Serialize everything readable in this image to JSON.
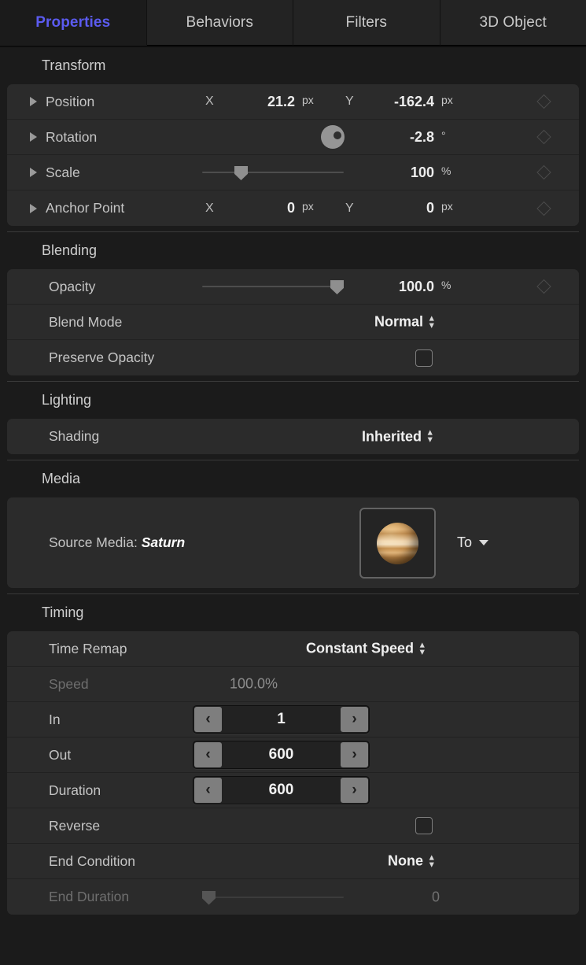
{
  "tabs": [
    {
      "label": "Properties",
      "active": true
    },
    {
      "label": "Behaviors",
      "active": false
    },
    {
      "label": "Filters",
      "active": false
    },
    {
      "label": "3D Object",
      "active": false
    }
  ],
  "sections": {
    "transform": {
      "title": "Transform",
      "position": {
        "label": "Position",
        "x_axis": "X",
        "x_value": "21.2",
        "x_unit": "px",
        "y_axis": "Y",
        "y_value": "-162.4",
        "y_unit": "px"
      },
      "rotation": {
        "label": "Rotation",
        "value": "-2.8",
        "unit": "°"
      },
      "scale": {
        "label": "Scale",
        "value": "100",
        "unit": "%"
      },
      "anchor": {
        "label": "Anchor Point",
        "x_axis": "X",
        "x_value": "0",
        "x_unit": "px",
        "y_axis": "Y",
        "y_value": "0",
        "y_unit": "px"
      }
    },
    "blending": {
      "title": "Blending",
      "opacity": {
        "label": "Opacity",
        "value": "100.0",
        "unit": "%"
      },
      "blend_mode": {
        "label": "Blend Mode",
        "value": "Normal"
      },
      "preserve_opacity": {
        "label": "Preserve Opacity",
        "checked": false
      }
    },
    "lighting": {
      "title": "Lighting",
      "shading": {
        "label": "Shading",
        "value": "Inherited"
      }
    },
    "media": {
      "title": "Media",
      "source_label": "Source Media:",
      "source_name": "Saturn",
      "to_label": "To"
    },
    "timing": {
      "title": "Timing",
      "time_remap": {
        "label": "Time Remap",
        "value": "Constant Speed"
      },
      "speed": {
        "label": "Speed",
        "value": "100.0%"
      },
      "in": {
        "label": "In",
        "value": "1"
      },
      "out": {
        "label": "Out",
        "value": "600"
      },
      "duration": {
        "label": "Duration",
        "value": "600"
      },
      "reverse": {
        "label": "Reverse",
        "checked": false
      },
      "end_condition": {
        "label": "End Condition",
        "value": "None"
      },
      "end_duration": {
        "label": "End Duration",
        "value": "0"
      }
    }
  },
  "icons": {
    "disclosure": "disclosure-triangle-icon",
    "keyframe": "keyframe-diamond-icon",
    "stepper_left": "‹",
    "stepper_right": "›",
    "up": "▴",
    "down": "▾"
  },
  "colors": {
    "accent": "#5b5bf0",
    "panel_bg": "#1b1b1b",
    "row_bg": "#2b2b2b",
    "text": "#c5c5c5"
  }
}
